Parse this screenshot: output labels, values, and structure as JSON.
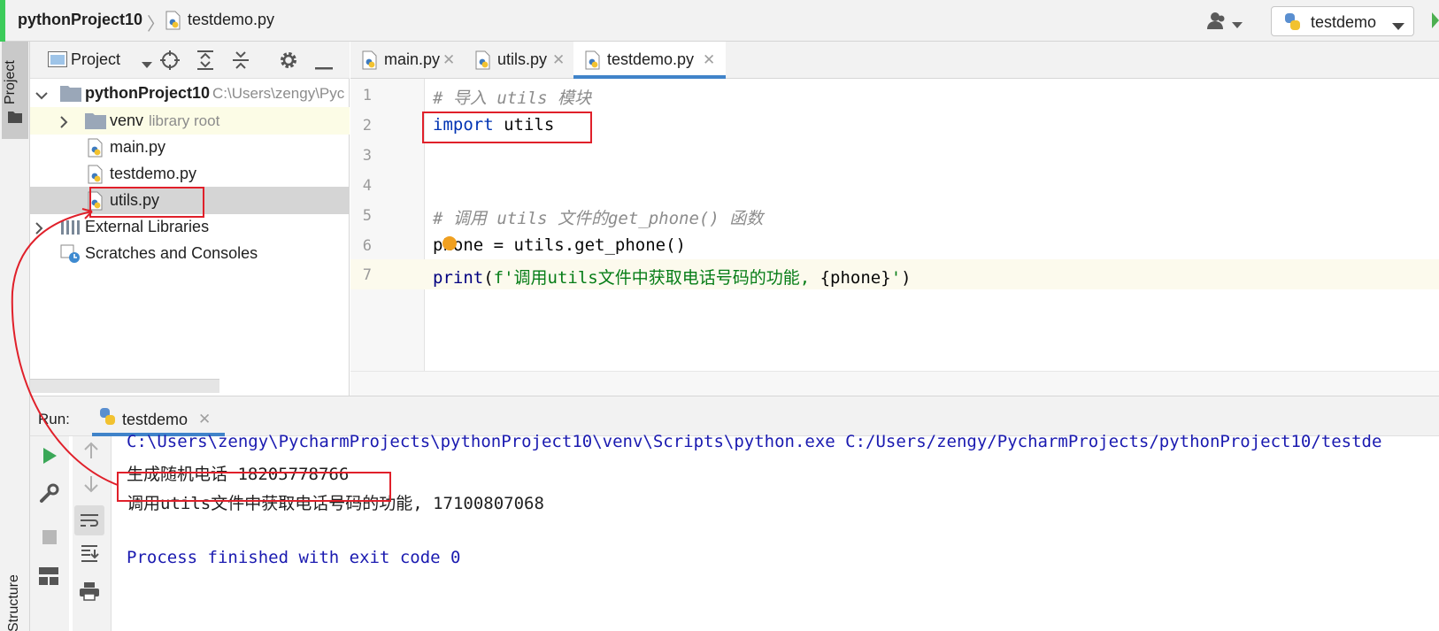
{
  "navbar": {
    "project_name": "pythonProject10",
    "separator": "〉",
    "file_name": "testdemo.py",
    "run_config": "testdemo"
  },
  "tool_windows": {
    "project_tab": "Project",
    "structure_tab": "Structure"
  },
  "project_panel": {
    "title": "Project",
    "tree": {
      "root": {
        "name": "pythonProject10",
        "path": "C:\\Users\\zengy\\Pyc"
      },
      "venv": {
        "name": "venv",
        "note": "library root"
      },
      "files": [
        "main.py",
        "testdemo.py",
        "utils.py"
      ],
      "external": "External Libraries",
      "scratches": "Scratches and Consoles"
    }
  },
  "editor": {
    "tabs": [
      "main.py",
      "utils.py",
      "testdemo.py"
    ],
    "active_tab": "testdemo.py",
    "line_numbers": [
      "1",
      "2",
      "3",
      "4",
      "5",
      "6",
      "7"
    ],
    "lines": {
      "l1": "# 导入 utils 模块",
      "l2_kw": "import",
      "l2_rest": " utils",
      "l5": "# 调用 utils 文件的get_phone() 函数",
      "l6": "phone = utils.get_phone()",
      "l7_fn": "print",
      "l7_open": "(",
      "l7_str1": "f'调用utils文件中获取电话号码的功能, ",
      "l7_expr": "{phone}",
      "l7_str2": "'",
      "l7_close": ")"
    }
  },
  "run_panel": {
    "label": "Run:",
    "tab": "testdemo",
    "output": [
      "C:\\Users\\zengy\\PycharmProjects\\pythonProject10\\venv\\Scripts\\python.exe C:/Users/zengy/PycharmProjects/pythonProject10/testde",
      "生成随机电话 18205778766",
      "调用utils文件中获取电话号码的功能, 17100807068",
      "",
      "Process finished with exit code 0"
    ]
  },
  "colors": {
    "accent": "#4083c9",
    "annotation": "#e0202a",
    "keyword": "#0033b3",
    "string": "#067d17",
    "comment": "#8c8c8c"
  }
}
